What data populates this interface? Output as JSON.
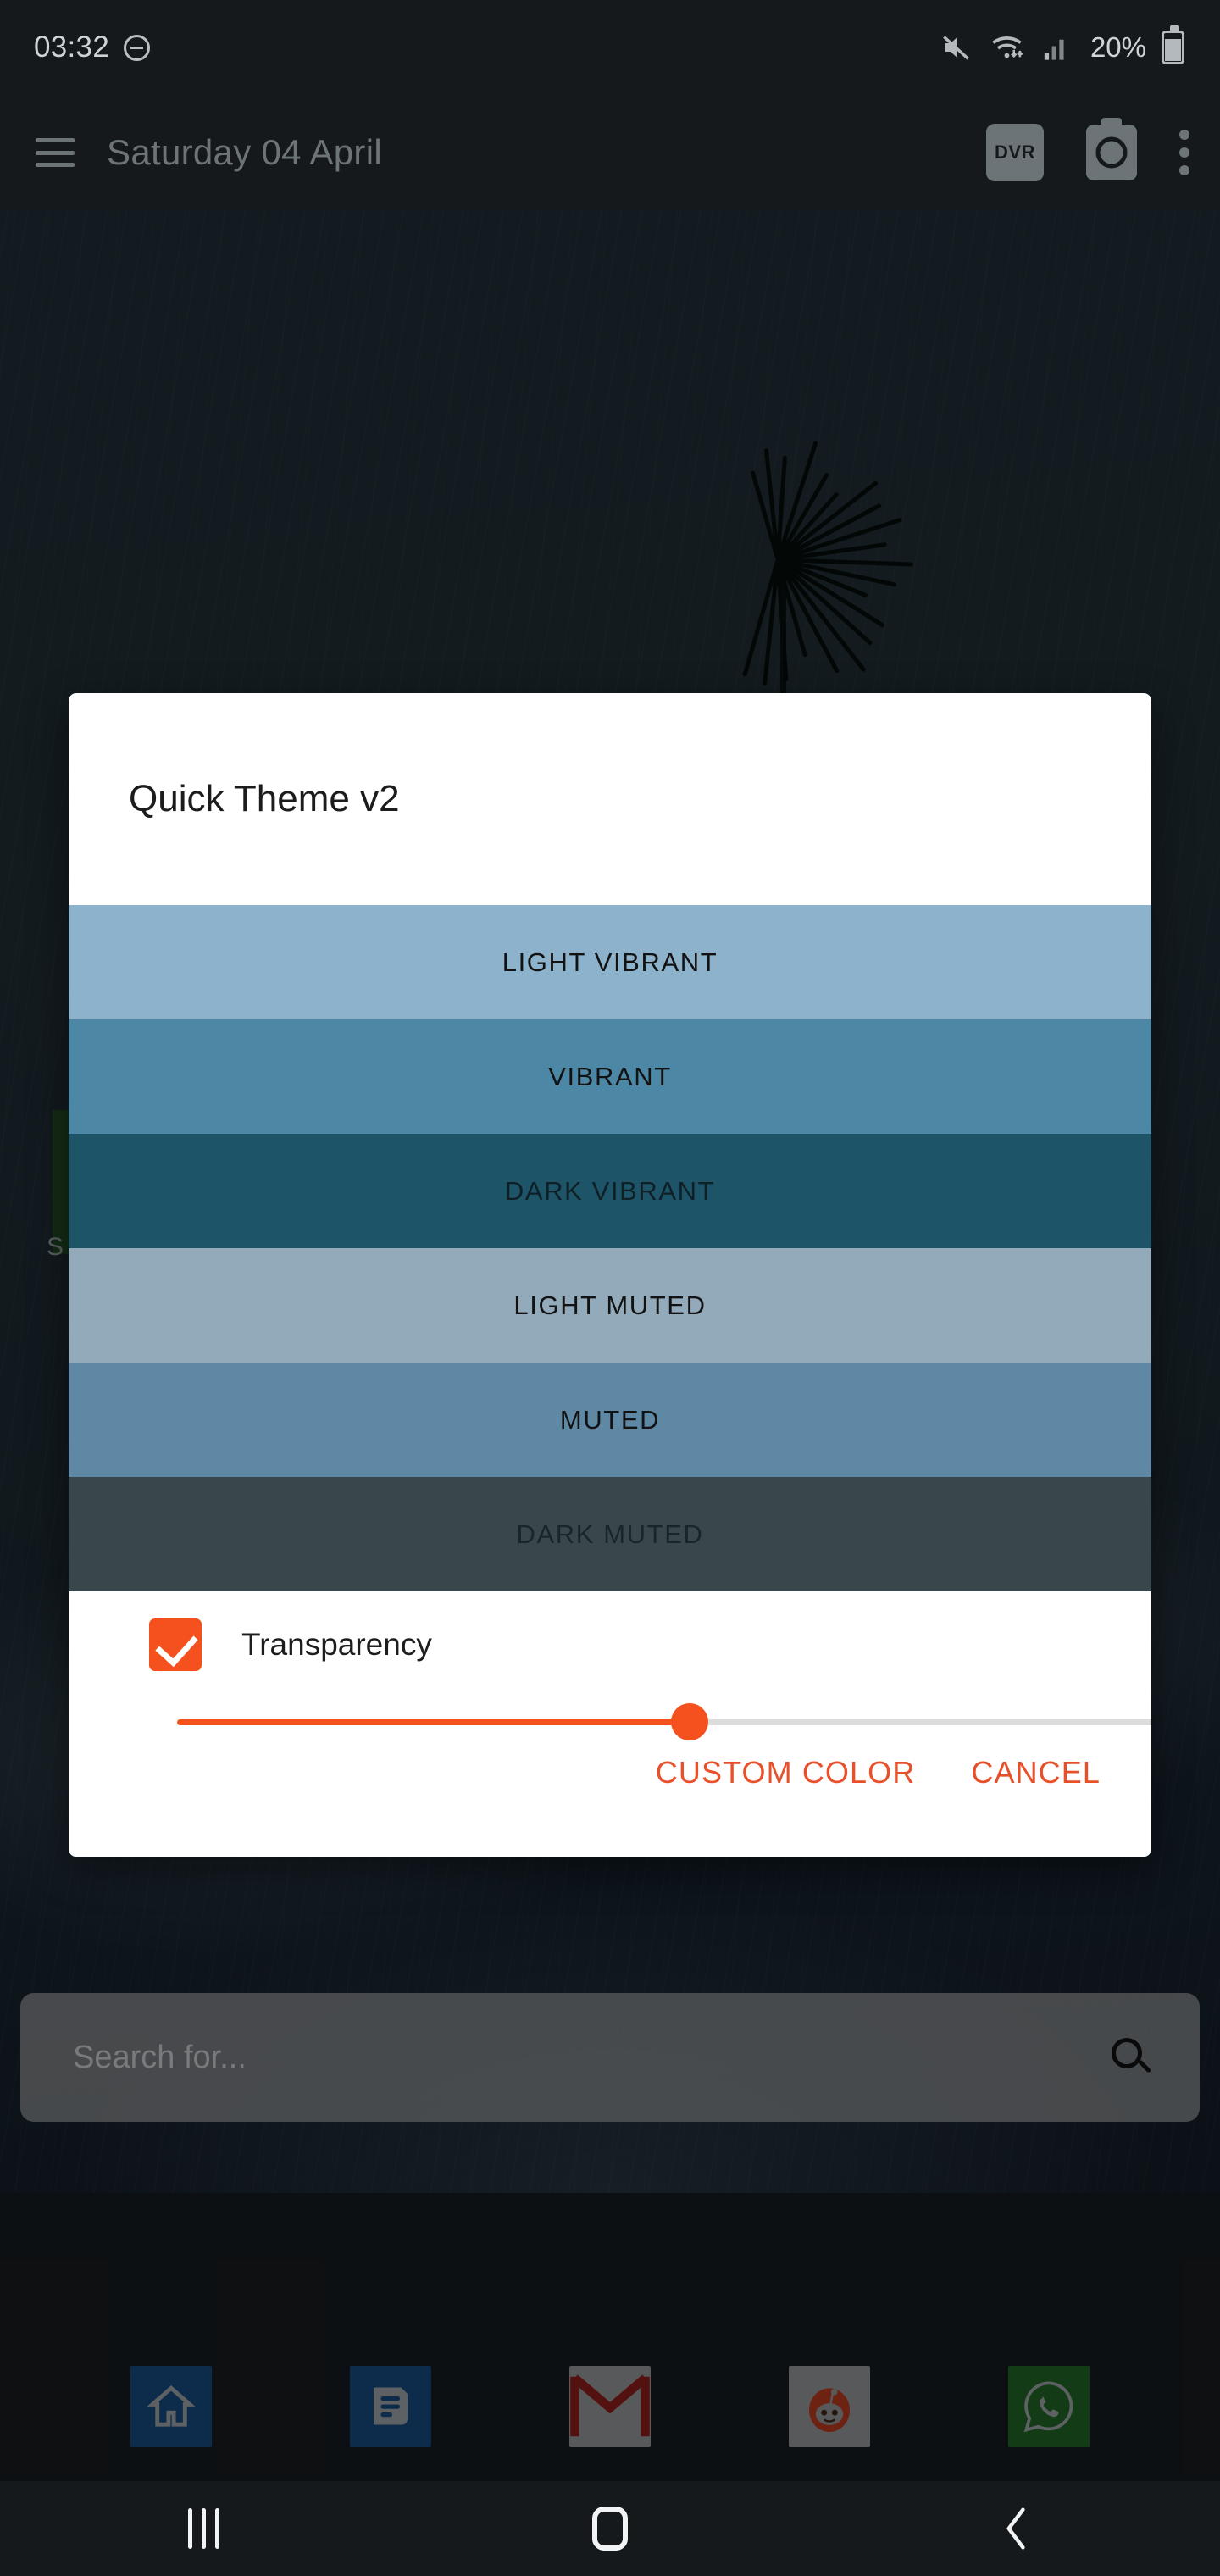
{
  "statusbar": {
    "time": "03:32",
    "dnd_icon": "do-not-disturb-icon",
    "mute_icon": "volume-muted-icon",
    "wifi_icon": "wifi-icon",
    "signal_icon": "cellular-signal-icon",
    "battery_percent": "20%",
    "battery_icon": "battery-icon"
  },
  "appbar": {
    "menu_icon": "hamburger-menu-icon",
    "title": "Saturday 04 April",
    "dvr_label": "DVR",
    "camera_icon": "camera-icon",
    "overflow_icon": "overflow-menu-icon"
  },
  "home": {
    "widget_label": "S",
    "widget_color": "#1f4420"
  },
  "dialog": {
    "title": "Quick Theme v2",
    "themes": [
      {
        "label": "LIGHT VIBRANT",
        "color": "#8db2cb",
        "text_color": "#121212"
      },
      {
        "label": "VIBRANT",
        "color": "#4c87a6",
        "text_color": "#121212"
      },
      {
        "label": "DARK VIBRANT",
        "color": "#1d5468",
        "text_color": "#0f1f26"
      },
      {
        "label": "LIGHT MUTED",
        "color": "#93aabb",
        "text_color": "#121212"
      },
      {
        "label": "MUTED",
        "color": "#5f88a5",
        "text_color": "#121212"
      },
      {
        "label": "DARK MUTED",
        "color": "#39474d",
        "text_color": "#19252a"
      }
    ],
    "transparency": {
      "label": "Transparency",
      "checked": true,
      "accent_color": "#f4511e",
      "slider_value": 51,
      "slider_min": 0,
      "slider_max": 100,
      "track_color": "#dcdcdc"
    },
    "actions": {
      "custom_color": "CUSTOM COLOR",
      "cancel": "CANCEL",
      "color": "#e8502a"
    }
  },
  "search": {
    "placeholder": "Search for...",
    "icon": "search-icon"
  },
  "dock": [
    {
      "name": "home-app",
      "icon": "house-icon",
      "bg": "#144272",
      "fg": "#8d9396"
    },
    {
      "name": "messages-app",
      "icon": "message-icon",
      "bg": "#144272",
      "fg": "#8d9396"
    },
    {
      "name": "gmail-app",
      "icon": "gmail-icon",
      "bg": "#858789",
      "fg": "#7e1a17"
    },
    {
      "name": "reddit-app",
      "icon": "reddit-alien-icon",
      "bg": "#858789",
      "fg": "#a8351a"
    },
    {
      "name": "whatsapp-app",
      "icon": "whatsapp-phone-icon",
      "bg": "#1d5c22",
      "fg": "#8d9396"
    }
  ],
  "navbar": {
    "recents": "recents-icon",
    "home": "home-icon",
    "back": "back-icon"
  }
}
